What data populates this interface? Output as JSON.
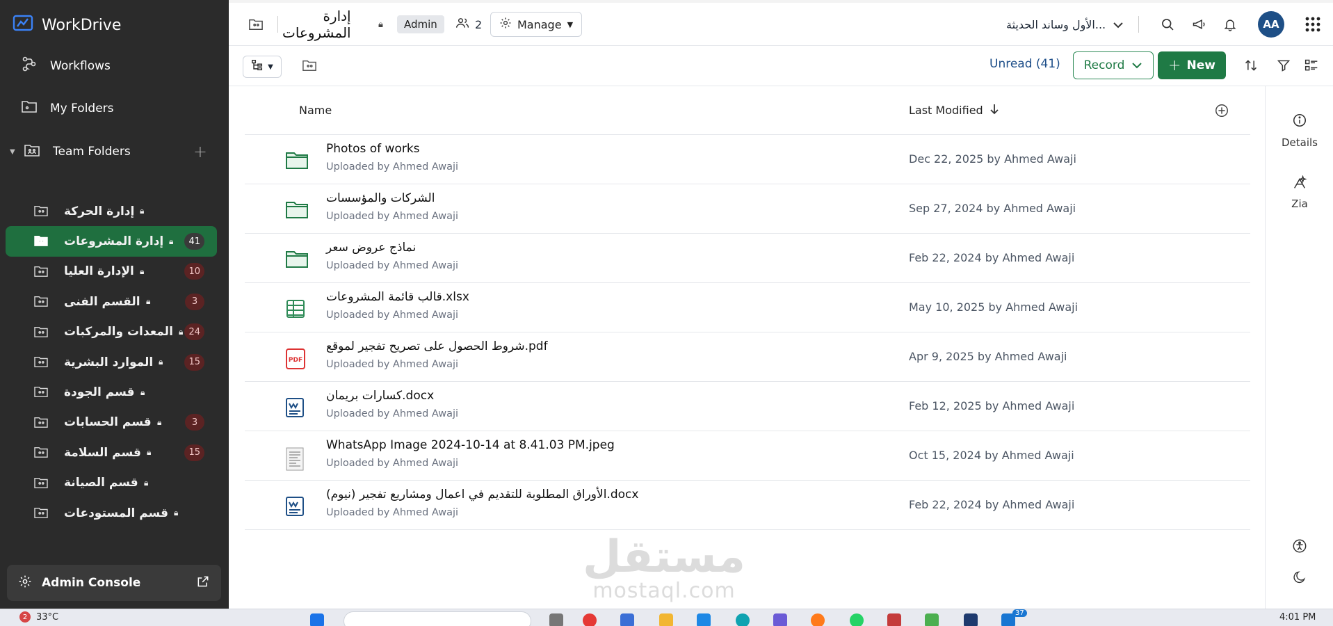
{
  "brand": {
    "name": "WorkDrive"
  },
  "sidebar": {
    "nav": [
      {
        "label": "Workflows",
        "icon": "workflow-icon"
      },
      {
        "label": "My Folders",
        "icon": "folder-icon"
      }
    ],
    "team_folders_label": "Team Folders",
    "folders": [
      {
        "name": "إدارة الحركة",
        "badge": "",
        "active": false
      },
      {
        "name": "إدارة المشروعات",
        "badge": "41",
        "active": true
      },
      {
        "name": "الإدارة العليا",
        "badge": "10",
        "active": false
      },
      {
        "name": "القسم الفنى",
        "badge": "3",
        "active": false
      },
      {
        "name": "المعدات والمركبات",
        "badge": "24",
        "active": false
      },
      {
        "name": "الموارد البشرية",
        "badge": "15",
        "active": false
      },
      {
        "name": "قسم الجودة",
        "badge": "",
        "active": false
      },
      {
        "name": "قسم الحسابات",
        "badge": "3",
        "active": false
      },
      {
        "name": "قسم السلامة",
        "badge": "15",
        "active": false
      },
      {
        "name": "قسم الصيانة",
        "badge": "",
        "active": false
      },
      {
        "name": "قسم المستودعات",
        "badge": "",
        "active": false
      }
    ],
    "admin_console_label": "Admin Console"
  },
  "topbar": {
    "title": "إدارة المشروعات",
    "role_badge": "Admin",
    "members_count": "2",
    "manage_label": "Manage",
    "org_name": "...الأول وساند الحديثة",
    "avatar_initials": "AA"
  },
  "toolbar": {
    "unread_label": "Unread (41)",
    "record_label": "Record",
    "new_label": "New"
  },
  "right_panel": {
    "details_label": "Details",
    "zia_label": "Zia"
  },
  "table": {
    "col_name": "Name",
    "col_modified": "Last Modified",
    "rows": [
      {
        "name": "Photos of works",
        "uploaded": "Uploaded by Ahmed Awaji",
        "modified": "Dec 22, 2025 by Ahmed Awaji",
        "type": "folder"
      },
      {
        "name": "الشركات والمؤسسات",
        "uploaded": "Uploaded by Ahmed Awaji",
        "modified": "Sep 27, 2024 by Ahmed Awaji",
        "type": "folder"
      },
      {
        "name": "نماذج عروض سعر",
        "uploaded": "Uploaded by Ahmed Awaji",
        "modified": "Feb 22, 2024 by Ahmed Awaji",
        "type": "folder"
      },
      {
        "name": "قالب قائمة المشروعات.xlsx",
        "uploaded": "Uploaded by Ahmed Awaji",
        "modified": "May 10, 2025 by Ahmed Awaji",
        "type": "xlsx"
      },
      {
        "name": "شروط الحصول على تصريح تفجير لموقع.pdf",
        "uploaded": "Uploaded by Ahmed Awaji",
        "modified": "Apr 9, 2025 by Ahmed Awaji",
        "type": "pdf"
      },
      {
        "name": "كسارات بريمان.docx",
        "uploaded": "Uploaded by Ahmed Awaji",
        "modified": "Feb 12, 2025 by Ahmed Awaji",
        "type": "docx"
      },
      {
        "name": "WhatsApp Image 2024-10-14 at 8.41.03 PM.jpeg",
        "uploaded": "Uploaded by Ahmed Awaji",
        "modified": "Oct 15, 2024 by Ahmed Awaji",
        "type": "image"
      },
      {
        "name": "الأوراق المطلوبة للتقديم في اعمال ومشاريع تفجير (نيوم).docx",
        "uploaded": "Uploaded by Ahmed Awaji",
        "modified": "Feb 22, 2024 by Ahmed Awaji",
        "type": "docx"
      }
    ]
  },
  "watermark": {
    "arabic": "مستقل",
    "latin": "mostaql.com"
  },
  "taskbar": {
    "weather_badge": "2",
    "temperature": "33°C",
    "mail_badge": "37",
    "time": "4:01 PM"
  },
  "colors": {
    "accent_green": "#1f7a45",
    "sidebar_bg": "#2b2b2b",
    "avatar_blue": "#1e4f86",
    "link_blue": "#1d4e89"
  }
}
